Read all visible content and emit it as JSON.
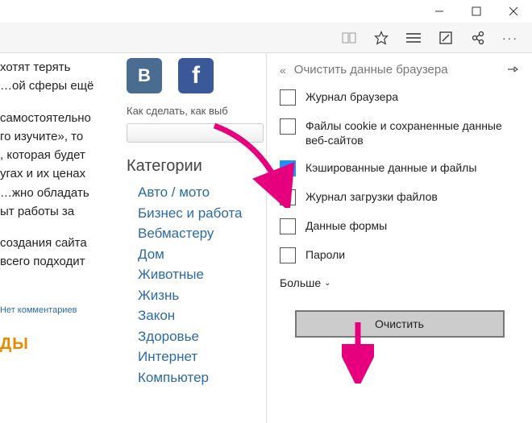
{
  "leftText": {
    "frag1": "        хотят    терять\n…ой  сферы  ещё",
    "frag2": "самостоятельно\nго  изучите», то\n,  которая  будет\nугах  и  их  ценах\n…жно    обладать\nыт   работы   за",
    "frag3": "создания сайта\n  всего  подходит",
    "noComments": "Нет комментариев",
    "orange": "ДЫ"
  },
  "mid": {
    "howto": "Как сделать, как выб",
    "categoriesHeading": "Категории",
    "categories": [
      "Авто / мото",
      "Бизнес и работа",
      "Вебмастеру",
      "Дом",
      "Животные",
      "Жизнь",
      "Закон",
      "Здоровье",
      "Интернет",
      "Компьютер"
    ]
  },
  "panel": {
    "title": "Очистить данные браузера",
    "options": [
      {
        "label": "Журнал браузера",
        "checked": false
      },
      {
        "label": "Файлы cookie и сохраненные данные веб-сайтов",
        "checked": false
      },
      {
        "label": "Кэшированные данные и файлы",
        "checked": true
      },
      {
        "label": "Журнал загрузки файлов",
        "checked": false
      },
      {
        "label": "Данные формы",
        "checked": false
      },
      {
        "label": "Пароли",
        "checked": false
      }
    ],
    "more": "Больше",
    "clear": "Очистить"
  },
  "social": {
    "vk": "B",
    "fb": "f"
  }
}
